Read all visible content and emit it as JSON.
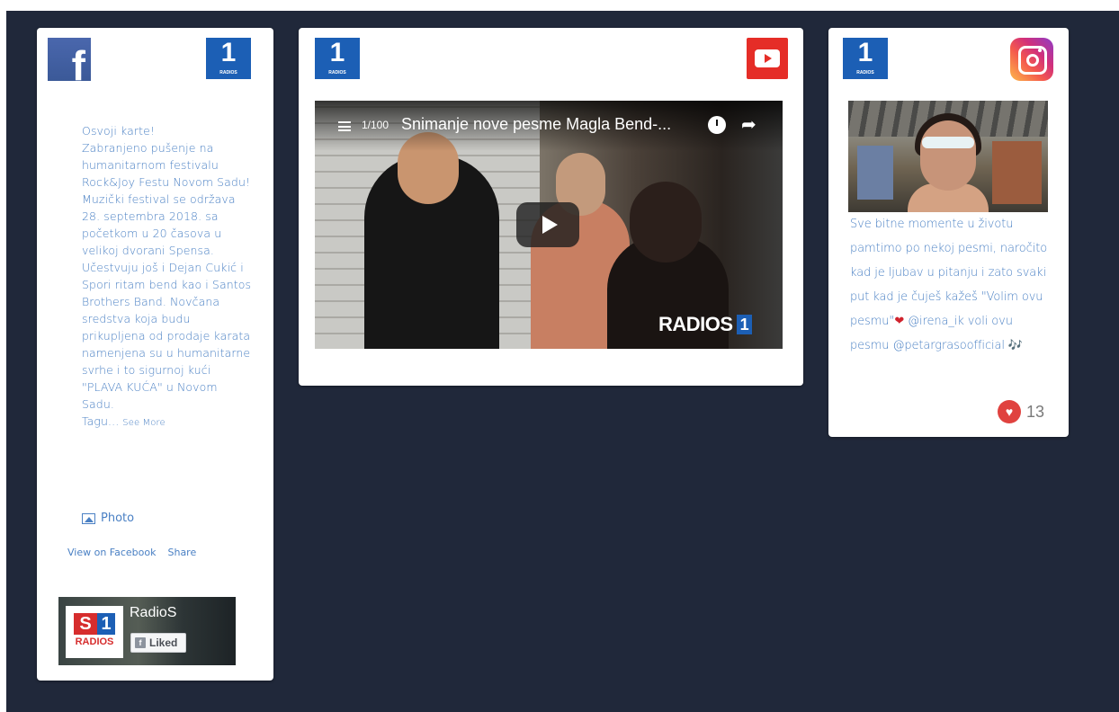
{
  "facebook": {
    "brand_mark": "f",
    "radio_logo": {
      "number": "1",
      "label": "RADIOS"
    },
    "paragraphs": [
      "Osvoji karte!",
      "Zabranjeno pušenje na humanitarnom festivalu Rock&Joy Festu Novom Sadu!",
      "Muzički festival se održava 28. septembra 2018. sa početkom u 20 časova u velikoj dvorani Spensa. Učestvuju još i Dejan Cukić i Spori ritam bend kao i Santos Brothers Band. Novčana sredstva koja budu prikupljena od prodaje karata namenjena su u humanitarne svrhe i to sigurnoj kući \"PLAVA KUĆA\" u Novom Sadu."
    ],
    "truncated_text": "Tagu...",
    "see_more": "See More",
    "photo_label": "Photo",
    "view_link": "View on Facebook",
    "share_link": "Share",
    "page_plugin": {
      "name": "RadioS",
      "liked_label": "Liked",
      "logo_letter_s": "S",
      "logo_number": "1",
      "logo_text": "RADIOS"
    }
  },
  "youtube": {
    "radio_logo": {
      "number": "1",
      "label": "RADIOS"
    },
    "video": {
      "playlist_position": "1/100",
      "title": "Snimanje nove pesme Magla Bend-...",
      "watermark": "RADIOS",
      "watermark_number": "1"
    }
  },
  "instagram": {
    "radio_logo": {
      "number": "1",
      "label": "RADIOS"
    },
    "caption_parts": {
      "text1": "Sve bitne momente u životu pamtimo po nekoj pesmi, naročito kad je ljubav u pitanju i zato svaki put kad je čuješ kažeš \"Volim ovu pesmu\"",
      "emoji1": "❤",
      "text2": " @irena_ik voli ovu pesmu @petargrasoofficial ",
      "emoji2": "🎶"
    },
    "likes": "13"
  },
  "colors": {
    "background": "#20283a",
    "text_link": "#4a80c4",
    "radio_blue": "#1c5fb5",
    "youtube_red": "#e52d27",
    "facebook_blue": "#3b5998"
  }
}
